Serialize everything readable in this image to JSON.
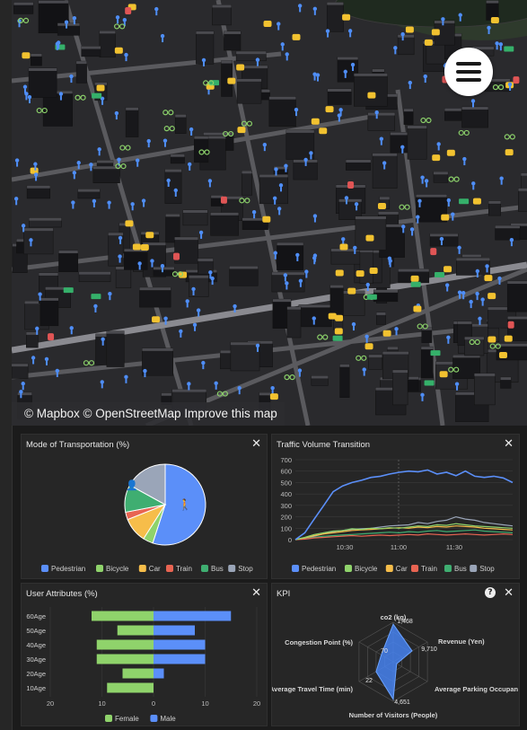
{
  "map": {
    "attribution": {
      "mapbox": "© Mapbox",
      "osm": "© OpenStreetMap",
      "improve": "Improve this map"
    },
    "menu_icon": "hamburger-menu-icon",
    "colors": {
      "pedestrian": "#4f8ef7",
      "car": "#f2c230",
      "bicycle": "#8bd06a",
      "bus": "#35b06a",
      "train": "#e05555"
    }
  },
  "panels": {
    "mode": {
      "title": "Mode of Transportation (%)",
      "close": "✕",
      "chart_data": {
        "type": "pie",
        "labels": [
          "Pedestrian",
          "Bicycle",
          "Car",
          "Train",
          "Bus",
          "Stop"
        ],
        "values": [
          55,
          4,
          10,
          3,
          11,
          17
        ],
        "colors": [
          "#5b8ff9",
          "#8fd36b",
          "#f6bd4a",
          "#e86452",
          "#3fae71",
          "#9aa5b8"
        ]
      },
      "legend": [
        "Pedestrian",
        "Bicycle",
        "Car",
        "Train",
        "Bus",
        "Stop"
      ]
    },
    "traffic": {
      "title": "Traffic Volume Transition",
      "close": "✕",
      "chart_data": {
        "type": "line",
        "x_ticks": [
          "10:30",
          "11:00",
          "11:30"
        ],
        "y_ticks": [
          0,
          100,
          200,
          300,
          400,
          500,
          600,
          700
        ],
        "ylim": [
          0,
          700
        ],
        "series": [
          {
            "name": "Pedestrian",
            "color": "#5b8ff9",
            "values": [
              0,
              60,
              180,
              300,
              420,
              470,
              500,
              520,
              545,
              555,
              575,
              590,
              600,
              595,
              610,
              575,
              590,
              560,
              600,
              555,
              545,
              555,
              540,
              500
            ]
          },
          {
            "name": "Bicycle",
            "color": "#8fd36b",
            "values": [
              0,
              20,
              45,
              60,
              75,
              80,
              95,
              90,
              100,
              95,
              105,
              100,
              110,
              120,
              115,
              130,
              125,
              140,
              130,
              120,
              115,
              110,
              105,
              100
            ]
          },
          {
            "name": "Car",
            "color": "#f6bd4a",
            "values": [
              0,
              15,
              35,
              50,
              60,
              70,
              80,
              85,
              90,
              95,
              100,
              105,
              100,
              110,
              105,
              115,
              110,
              120,
              115,
              110,
              100,
              95,
              90,
              85
            ]
          },
          {
            "name": "Train",
            "color": "#e86452",
            "values": [
              0,
              5,
              15,
              20,
              25,
              30,
              35,
              30,
              35,
              40,
              35,
              40,
              45,
              40,
              50,
              45,
              40,
              45,
              50,
              45,
              40,
              45,
              50,
              45
            ]
          },
          {
            "name": "Bus",
            "color": "#3fae71",
            "values": [
              0,
              10,
              20,
              30,
              35,
              40,
              45,
              50,
              55,
              60,
              65,
              60,
              70,
              65,
              75,
              80,
              70,
              75,
              80,
              85,
              75,
              70,
              65,
              60
            ]
          },
          {
            "name": "Stop",
            "color": "#9aa5b8",
            "values": [
              0,
              10,
              30,
              50,
              70,
              80,
              90,
              95,
              100,
              110,
              120,
              125,
              130,
              150,
              140,
              160,
              170,
              200,
              180,
              170,
              150,
              140,
              130,
              120
            ]
          }
        ]
      },
      "legend": [
        "Pedestrian",
        "Bicycle",
        "Car",
        "Train",
        "Bus",
        "Stop"
      ]
    },
    "user": {
      "title": "User Attributes (%)",
      "close": "✕",
      "chart_data": {
        "type": "bar",
        "categories": [
          "60Age",
          "50Age",
          "40Age",
          "30Age",
          "20Age",
          "10Age"
        ],
        "series": [
          {
            "name": "Female",
            "color": "#8fd36b",
            "values": [
              12,
              7,
              11,
              11,
              6,
              9
            ]
          },
          {
            "name": "Male",
            "color": "#5b8ff9",
            "values": [
              15,
              8,
              10,
              10,
              2,
              0
            ]
          }
        ],
        "x_ticks": [
          "20",
          "10",
          "0",
          "10",
          "20"
        ],
        "xlim": [
          -20,
          20
        ]
      },
      "legend": [
        "Female",
        "Male"
      ]
    },
    "kpi": {
      "title": "KPI",
      "close": "✕",
      "help": "?",
      "chart_data": {
        "type": "radar",
        "axes": [
          "co2 (kg)",
          "Revenue (Yen)",
          "Average Parking Occupan",
          "Number of Visitors (People)",
          "Average Travel Time (min)",
          "Congestion Point (%)"
        ],
        "values": [
          1.468,
          9.71,
          0,
          4.651,
          22,
          70
        ],
        "normalized": [
          0.95,
          0.55,
          0.1,
          0.95,
          0.5,
          0.35
        ],
        "value_labels": [
          "1,468",
          "9,710",
          "",
          "4,651",
          "22",
          "70"
        ]
      }
    }
  }
}
